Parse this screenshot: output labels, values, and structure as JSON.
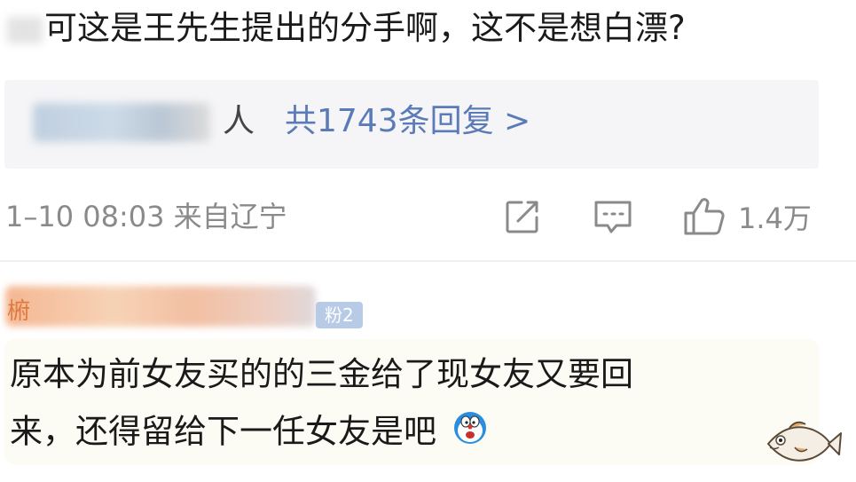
{
  "comment": {
    "text": "可这是王先生提出的分手啊，这不是想白漂?"
  },
  "replies": {
    "user_suffix": "人",
    "more_label": "共1743条回复 >"
  },
  "meta": {
    "time_location": "1–10 08:03 来自辽宁",
    "like_count": "1.4万"
  },
  "reply_comment": {
    "user_initial": "椨",
    "badge_label": "粉2",
    "line1": "原本为前女友买的的三金给了现女友又要回",
    "line2": "来，还得留给下一任女友是吧"
  },
  "icons": [
    "share-icon",
    "comment-icon",
    "like-icon",
    "doraemon-emoji-icon",
    "fish-sticker-icon"
  ],
  "colors": {
    "link": "#5b7bb8",
    "muted": "#8a8a8a",
    "reply_bg": "#f5f5f7",
    "bubble_bg": "#fdfcf4"
  }
}
